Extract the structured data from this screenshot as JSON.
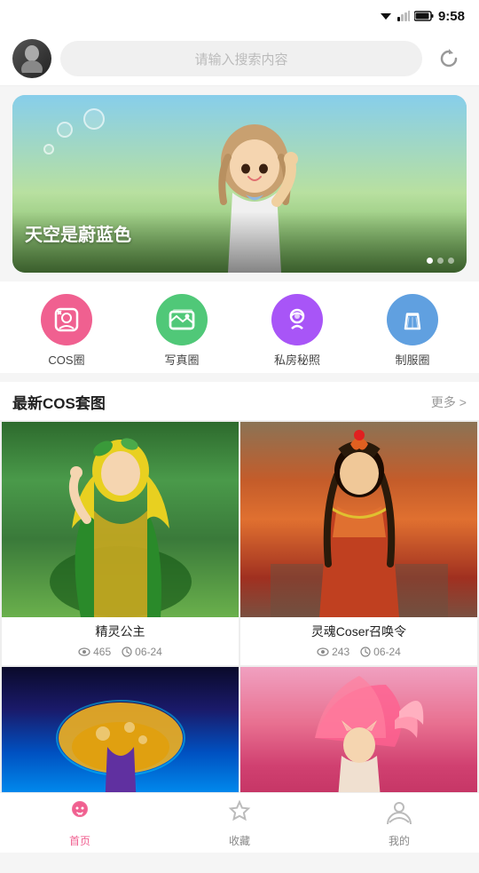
{
  "statusBar": {
    "time": "9:58"
  },
  "header": {
    "searchPlaceholder": "请输入搜索内容",
    "refreshIcon": "↻"
  },
  "banner": {
    "title": "天空是蔚蓝色",
    "dots": [
      true,
      false,
      false
    ],
    "activeDot": 0
  },
  "categories": [
    {
      "id": "cos-circle",
      "label": "COS圈",
      "color": "pink",
      "emoji": "👻"
    },
    {
      "id": "photo-circle",
      "label": "写真圈",
      "color": "green",
      "emoji": "🖼"
    },
    {
      "id": "private-secret",
      "label": "私房秘照",
      "color": "purple",
      "emoji": "🧝"
    },
    {
      "id": "uniform-circle",
      "label": "制服圈",
      "color": "blue",
      "emoji": "👗"
    }
  ],
  "sectionLatest": {
    "title": "最新COS套图",
    "more": "更多 >"
  },
  "cosCards": [
    {
      "id": "card1",
      "title": "精灵公主",
      "views": "465",
      "date": "06-24",
      "imgClass": "green-forest"
    },
    {
      "id": "card2",
      "title": "灵魂Coser召唤令",
      "views": "243",
      "date": "06-24",
      "imgClass": "red-warrior"
    },
    {
      "id": "card3",
      "title": "",
      "views": "",
      "date": "",
      "imgClass": "neon"
    },
    {
      "id": "card4",
      "title": "",
      "views": "",
      "date": "",
      "imgClass": "pink-fan"
    }
  ],
  "bottomNav": [
    {
      "id": "home",
      "label": "首页",
      "icon": "🐰",
      "active": true
    },
    {
      "id": "favorites",
      "label": "收藏",
      "icon": "☆",
      "active": false
    },
    {
      "id": "profile",
      "label": "我的",
      "icon": "👤",
      "active": false
    }
  ],
  "icons": {
    "eye": "👁",
    "clock": "⏱",
    "wifi": "▼",
    "battery": "🔋"
  }
}
